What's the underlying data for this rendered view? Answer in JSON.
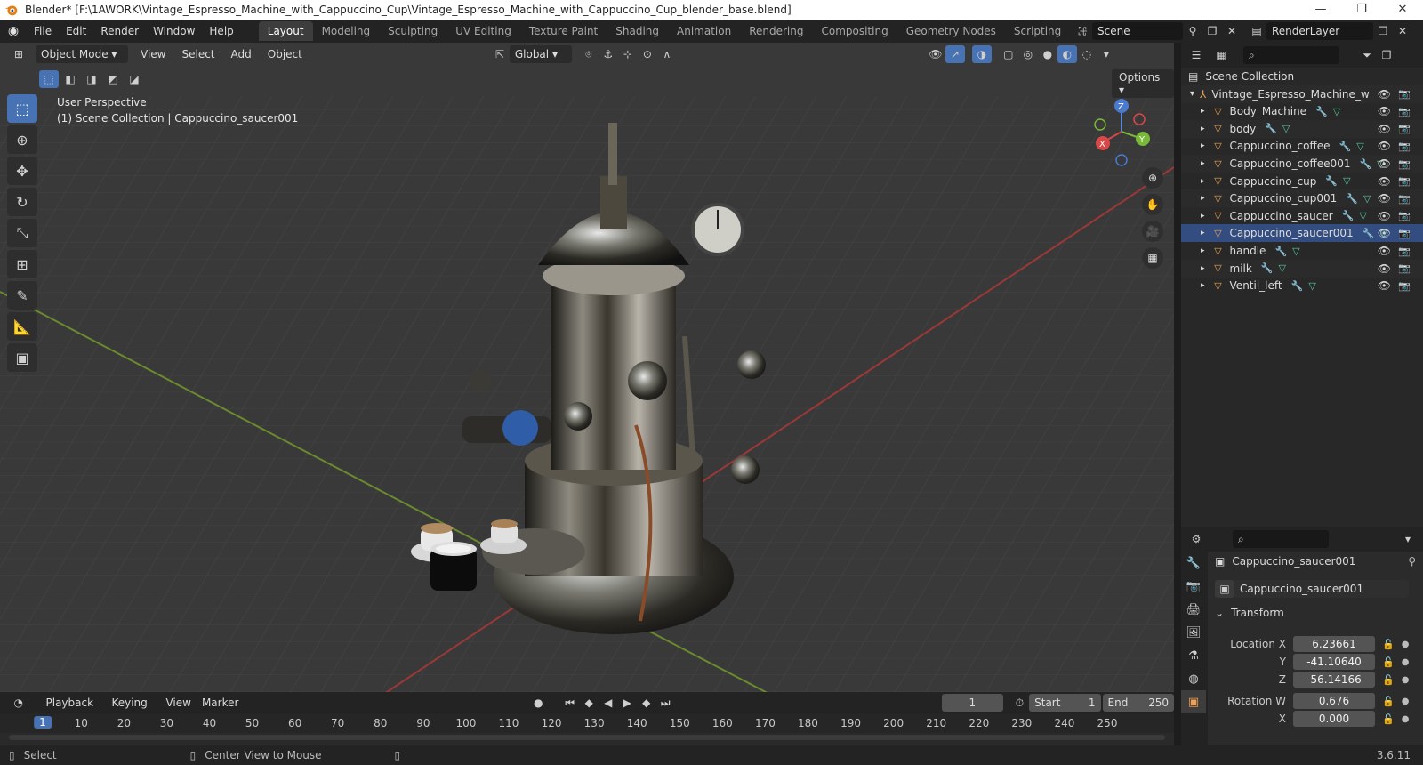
{
  "window": {
    "title": "Blender* [F:\\1AWORK\\Vintage_Espresso_Machine_with_Cappuccino_Cup\\Vintage_Espresso_Machine_with_Cappuccino_Cup_blender_base.blend]",
    "minimize": "—",
    "maximize": "❐",
    "close": "✕"
  },
  "menu": [
    "File",
    "Edit",
    "Render",
    "Window",
    "Help"
  ],
  "workspaces": [
    "Layout",
    "Modeling",
    "Sculpting",
    "UV Editing",
    "Texture Paint",
    "Shading",
    "Animation",
    "Rendering",
    "Compositing",
    "Geometry Nodes",
    "Scripting"
  ],
  "active_workspace": "Layout",
  "add_workspace": "+",
  "scene": {
    "name": "Scene",
    "render_layer": "RenderLayer"
  },
  "viewport": {
    "mode": "Object Mode",
    "menus": [
      "View",
      "Select",
      "Add",
      "Object"
    ],
    "orientation": "Global",
    "options": "Options",
    "perspective_label": "User Perspective",
    "collection_label": "(1) Scene Collection | Cappuccino_saucer001",
    "gizmo": {
      "x": "X",
      "y": "Y",
      "z": "Z"
    }
  },
  "timeline": {
    "menus": [
      "Playback",
      "Keying",
      "View",
      "Marker"
    ],
    "current_frame": "1",
    "start_label": "Start",
    "start": "1",
    "end_label": "End",
    "end": "250",
    "ruler": [
      "1",
      "10",
      "20",
      "30",
      "40",
      "50",
      "60",
      "70",
      "80",
      "90",
      "100",
      "110",
      "120",
      "130",
      "140",
      "150",
      "160",
      "170",
      "180",
      "190",
      "200",
      "210",
      "220",
      "230",
      "240",
      "250"
    ]
  },
  "status": {
    "select": "Select",
    "center": "Center View to Mouse",
    "version": "3.6.11"
  },
  "outliner": {
    "root": "Scene Collection",
    "collection": "Vintage_Espresso_Machine_w",
    "items": [
      "Body_Machine",
      "body",
      "Cappuccino_coffee",
      "Cappuccino_coffee001",
      "Cappuccino_cup",
      "Cappuccino_cup001",
      "Cappuccino_saucer",
      "Cappuccino_saucer001",
      "handle",
      "milk",
      "Ventil_left"
    ],
    "selected": "Cappuccino_saucer001"
  },
  "properties": {
    "object_name": "Cappuccino_saucer001",
    "data_name": "Cappuccino_saucer001",
    "panel": "Transform",
    "location_label": "Location X",
    "loc_y_label": "Y",
    "loc_z_label": "Z",
    "rotation_label": "Rotation W",
    "rot_x_label": "X",
    "location_x": "6.23661",
    "location_y": "-41.10640",
    "location_z": "-56.14166",
    "rotation_w": "0.676",
    "rotation_x": "0.000"
  }
}
